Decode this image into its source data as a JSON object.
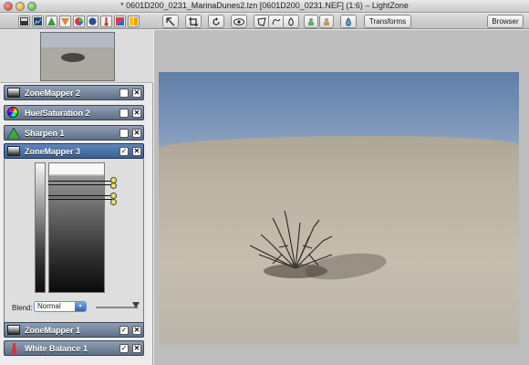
{
  "window": {
    "title": "* 0601D200_0231_MarinaDunes2.lzn [0601D200_0231.NEF] (1:6) – LightZone"
  },
  "toolbar": {
    "left_icons": [
      "zonemapper-tool-icon",
      "histogram-tool-icon",
      "sharpen-tool-icon",
      "relight-tool-icon",
      "hue-saturation-tool-icon",
      "noise-reduction-tool-icon",
      "white-balance-tool-icon",
      "color-balance-tool-icon",
      "color-picker-tool-icon"
    ],
    "center_icons": [
      "arrow-select-icon",
      "crop-icon",
      "rotate-icon",
      "eye-icon",
      "region-polygon-icon",
      "region-spline-icon",
      "region-freehand-icon",
      "clone-icon",
      "heal-icon",
      "red-eye-icon"
    ],
    "transforms_label": "Transforms",
    "browser_label": "Browser"
  },
  "tools": [
    {
      "name": "ZoneMapper 2",
      "checked": false,
      "active": false
    },
    {
      "name": "Hue/Saturation 2",
      "checked": false,
      "active": false
    },
    {
      "name": "Sharpen 1",
      "checked": false,
      "active": false
    },
    {
      "name": "ZoneMapper 3",
      "checked": true,
      "active": true
    },
    {
      "name": "ZoneMapper 1",
      "checked": true,
      "active": false
    },
    {
      "name": "White Balance 1",
      "checked": true,
      "active": false
    }
  ],
  "zonemapper": {
    "blend_label": "Blend:",
    "blend_value": "Normal"
  },
  "colors": {
    "tool_header": "#5d6f86",
    "tool_header_active": "#3a5f92",
    "sky": "#6f8bb2",
    "sand": "#c2b9ab"
  }
}
